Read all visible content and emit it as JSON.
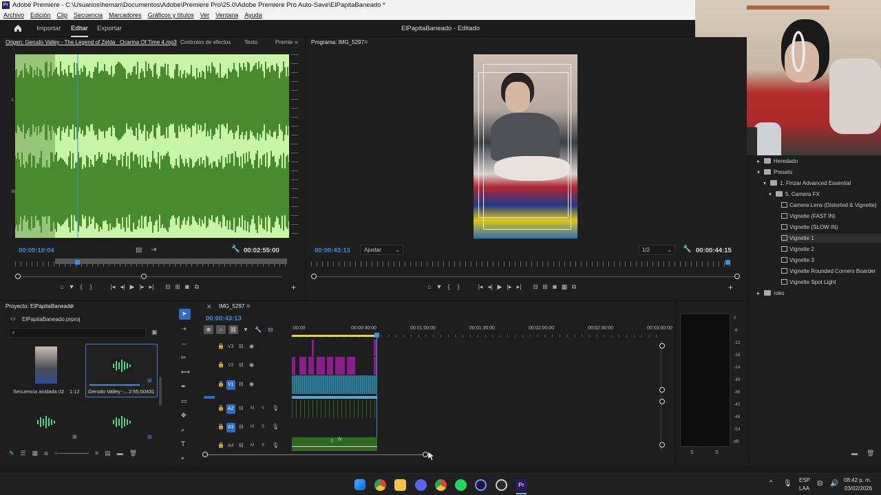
{
  "window": {
    "title": "Adobe Premiere - C:\\Usuarios\\heman\\Documentos\\Adobe\\Premiere Pro\\25.0\\Adobe Premiere Pro Auto-Save\\ElPapitaBaneado *",
    "logo": "Pr"
  },
  "menu": [
    "Archivo",
    "Edición",
    "Clip",
    "Secuencia",
    "Marcadores",
    "Gráficos y títulos",
    "Ver",
    "Ventana",
    "Ayuda"
  ],
  "header": {
    "tabs": [
      "Importar",
      "Editar",
      "Exportar"
    ],
    "active_tab": "Editar",
    "project_status": "ElPapitaBaneado - Editado"
  },
  "source_panel": {
    "tabs": [
      "Origen: Gerudo Valley - The Legend of Zelda_ Ocarina Of Time 4.mp3",
      "Controles de efectos",
      "Texto",
      "Premie"
    ],
    "channel_labels": [
      "L",
      "R"
    ],
    "timecode_current": "00:00:10:04",
    "timecode_duration": "00:02:55:00"
  },
  "program_panel": {
    "title": "Programa: IMG_5297",
    "timecode_current": "00:00:43:13",
    "fit_select": "Ajustar",
    "resolution_select": "1/2",
    "timecode_duration": "00:00:44:15"
  },
  "project_panel": {
    "title": "Proyecto: ElPapitaBaneado",
    "file": "ElPapitaBaneado.prproj",
    "search_placeholder": "",
    "items": [
      {
        "name": "Secuencia anidada 02",
        "duration": "1:12"
      },
      {
        "name": "Gerudo Valley -...",
        "duration": "2:55:00431"
      }
    ]
  },
  "timeline": {
    "sequence": "IMG_5297",
    "timecode": "00:00:43:13",
    "ruler_labels": [
      ":00:00",
      "00:00:30:00",
      "00:01:00:00",
      "00:01:30:00",
      "00:02:00:00",
      "00:02:30:00",
      "00:03:00:00"
    ],
    "video_tracks": [
      "V3",
      "V2",
      "V1"
    ],
    "audio_tracks": [
      "A2",
      "A3",
      "A4"
    ],
    "audio_flags": [
      "M",
      "S"
    ]
  },
  "meter": {
    "scale": [
      "0",
      "-6",
      "-12",
      "-18",
      "-24",
      "-30",
      "-36",
      "-42",
      "-48",
      "-54",
      "dB"
    ],
    "solo": [
      "S",
      "S"
    ]
  },
  "effects_panel": {
    "tree": [
      {
        "label": "Heredado",
        "level": 0,
        "expanded": false
      },
      {
        "label": "Presets",
        "level": 0,
        "expanded": true
      },
      {
        "label": "1. Finzar Advanced Essential",
        "level": 1,
        "expanded": true
      },
      {
        "label": "5. Camera FX",
        "level": 2,
        "expanded": true
      },
      {
        "label": "Camera Lens (Distorted & Vignette)",
        "level": 3
      },
      {
        "label": "Vignette (FAST IN)",
        "level": 3
      },
      {
        "label": "Vignette (SLOW IN)",
        "level": 3
      },
      {
        "label": "Vignette 1",
        "level": 3,
        "selected": true
      },
      {
        "label": "Vignette 2",
        "level": 3
      },
      {
        "label": "Vignette 3",
        "level": 3
      },
      {
        "label": "Vignette Rounded Corners Boarder",
        "level": 3
      },
      {
        "label": "Vignette Spot Light",
        "level": 3
      },
      {
        "label": "roko",
        "level": 0,
        "expanded": false
      }
    ]
  },
  "taskbar": {
    "lang": "ESP",
    "lang2": "LAA",
    "time": "08:42 p. m.",
    "date": "03/02/2026"
  },
  "colors": {
    "accent_blue": "#2f6bc7",
    "timecode_blue": "#3d8ee6",
    "waveform_bg": "#c8f5a8",
    "waveform": "#4a8a2e",
    "clip_purple": "#8a1e8a",
    "clip_teal": "#1f6b86",
    "clip_audio": "#2f6b1f"
  }
}
